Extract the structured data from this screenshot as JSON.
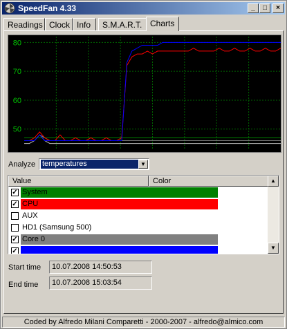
{
  "window": {
    "title": "SpeedFan 4.33"
  },
  "tabs": [
    {
      "label": "Readings",
      "active": false
    },
    {
      "label": "Clock",
      "active": false
    },
    {
      "label": "Info",
      "active": false
    },
    {
      "label": "S.M.A.R.T.",
      "active": false
    },
    {
      "label": "Charts",
      "active": true
    }
  ],
  "analyze": {
    "label": "Analyze",
    "selected": "temperatures"
  },
  "list": {
    "columns": [
      "Value",
      "Color"
    ],
    "rows": [
      {
        "label": "System",
        "checked": true,
        "color": "#008000"
      },
      {
        "label": "CPU",
        "checked": true,
        "color": "#ff0000"
      },
      {
        "label": "AUX",
        "checked": false,
        "color": ""
      },
      {
        "label": "HD1 (Samsung 500)",
        "checked": false,
        "color": ""
      },
      {
        "label": "Core 0",
        "checked": true,
        "color": "#808080"
      },
      {
        "label": "",
        "checked": true,
        "color": "#0000ff"
      }
    ]
  },
  "times": {
    "start_label": "Start time",
    "start_value": "10.07.2008 14:50:53",
    "end_label": "End time",
    "end_value": "10.07.2008 15:03:54"
  },
  "status": "Coded by Alfredo Milani Comparetti - 2000-2007 - alfredo@almico.com",
  "chart_data": {
    "type": "line",
    "ylim": [
      43,
      82
    ],
    "yticks": [
      50,
      60,
      70,
      80
    ],
    "grid": true,
    "x": [
      0,
      2,
      4,
      6,
      8,
      10,
      12,
      14,
      16,
      18,
      20,
      22,
      24,
      26,
      28,
      30,
      32,
      34,
      36,
      38,
      40,
      42,
      44,
      46,
      48,
      50,
      52,
      54,
      56,
      58,
      60,
      62,
      64,
      66,
      68,
      70,
      72,
      74,
      76,
      78,
      80,
      82,
      84,
      86,
      88,
      90,
      92,
      94,
      96,
      98,
      100
    ],
    "series": [
      {
        "color": "#008000",
        "values": [
          47,
          47,
          47,
          47,
          47,
          47,
          47,
          47,
          47,
          47,
          47,
          47,
          47,
          47,
          47,
          47,
          47,
          47,
          47,
          47,
          47,
          47,
          47,
          47,
          47,
          47,
          47,
          47,
          47,
          47,
          47,
          47,
          47,
          47,
          47,
          47,
          47,
          47,
          47,
          47,
          47,
          47,
          47,
          47,
          47,
          47,
          47,
          47,
          47,
          47,
          47
        ]
      },
      {
        "color": "#c0c0c0",
        "values": [
          45,
          45,
          46,
          48,
          46,
          45,
          45,
          45,
          45,
          45,
          45,
          45,
          45,
          45,
          45,
          45,
          45,
          45,
          45,
          45,
          45,
          45,
          45,
          45,
          45,
          45,
          45,
          45,
          45,
          45,
          45,
          45,
          45,
          45,
          45,
          45,
          45,
          45,
          45,
          45,
          45,
          45,
          45,
          45,
          45,
          45,
          45,
          45,
          45,
          45,
          45
        ]
      },
      {
        "color": "#808080",
        "values": [
          46,
          46,
          46,
          48,
          47,
          46,
          46,
          46,
          46,
          46,
          46,
          46,
          46,
          46,
          46,
          46,
          46,
          46,
          46,
          46,
          46,
          46,
          46,
          46,
          46,
          46,
          46,
          46,
          46,
          46,
          46,
          46,
          46,
          46,
          46,
          46,
          46,
          46,
          46,
          46,
          46,
          46,
          46,
          46,
          46,
          46,
          46,
          46,
          46,
          46,
          46
        ]
      },
      {
        "color": "#ff0000",
        "values": [
          46,
          46,
          47,
          49,
          47,
          46,
          46,
          48,
          46,
          46,
          47,
          46,
          46,
          47,
          46,
          46,
          47,
          46,
          46,
          47,
          72,
          75,
          76,
          76,
          77,
          76,
          77,
          77,
          77,
          77,
          77,
          77,
          77,
          78,
          77,
          77,
          77,
          77,
          78,
          77,
          77,
          78,
          77,
          77,
          78,
          77,
          77,
          78,
          77,
          77,
          78
        ]
      },
      {
        "color": "#0000ff",
        "values": [
          46,
          46,
          46,
          48,
          46,
          46,
          46,
          46,
          46,
          46,
          46,
          46,
          46,
          46,
          46,
          46,
          46,
          46,
          46,
          46,
          73,
          77,
          78,
          79,
          79,
          79,
          79,
          80,
          80,
          80,
          80,
          80,
          80,
          80,
          80,
          80,
          80,
          80,
          80,
          80,
          80,
          80,
          80,
          80,
          80,
          80,
          80,
          80,
          80,
          80,
          80
        ]
      }
    ]
  }
}
